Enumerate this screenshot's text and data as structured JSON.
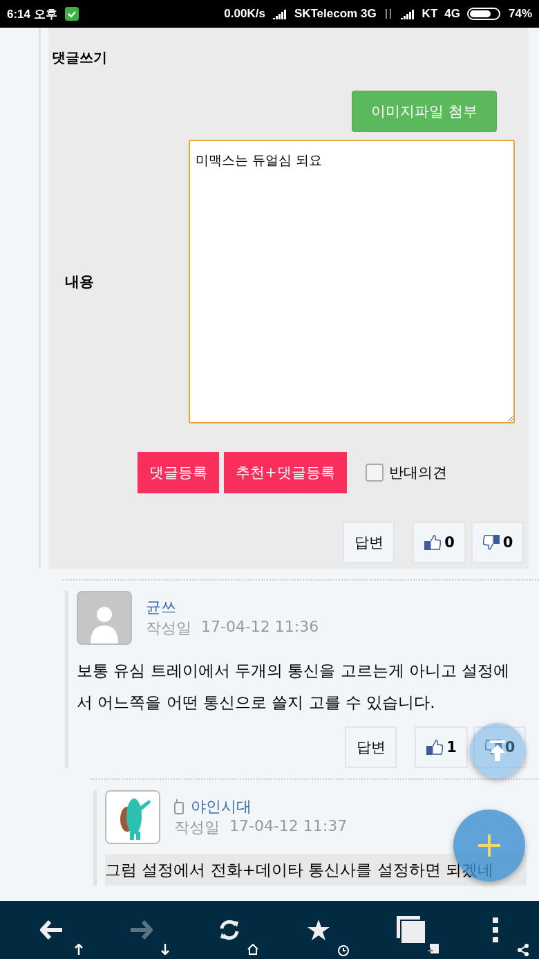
{
  "status_bar": {
    "time": "6:14 오후",
    "speed": "0.00K/s",
    "carrier_1": "SKTelecom 3G",
    "carrier_2": "KT",
    "network_2": "4G",
    "battery": "74%"
  },
  "comment_form": {
    "title": "댓글쓰기",
    "attach_button": "이미지파일 첨부",
    "content_label": "내용",
    "content_value": "미맥스는 듀얼심 되요\n",
    "buttons": [
      "댓글등록",
      "추천+댓글등록"
    ],
    "opposite": {
      "label": "반대의견",
      "checked": false
    },
    "reply": "답변",
    "likes": "0",
    "dislikes": "0"
  },
  "comments": [
    {
      "name": "균쓰",
      "mobile": false,
      "avatar": {
        "kind": "default"
      },
      "date_label": "작성일",
      "date": "17-04-12 11:36",
      "body": "보통 유심 트레이에서 두개의 통신을 고르는게 아니고 설정에서 어느쪽을 어떤 통신으로 쓸지 고를 수 있습니다.",
      "highlighted": false,
      "reply": "답변",
      "likes": "1",
      "dislikes": "0"
    },
    {
      "name": "야인시대",
      "mobile": true,
      "date_label": "작성일",
      "date": "17-04-12 11:37",
      "body": "그럼 설정에서 전화+데이타 통신사를 설정하면 되겠네",
      "highlighted": true
    }
  ],
  "browser_bar": {
    "forward_enabled": false
  }
}
